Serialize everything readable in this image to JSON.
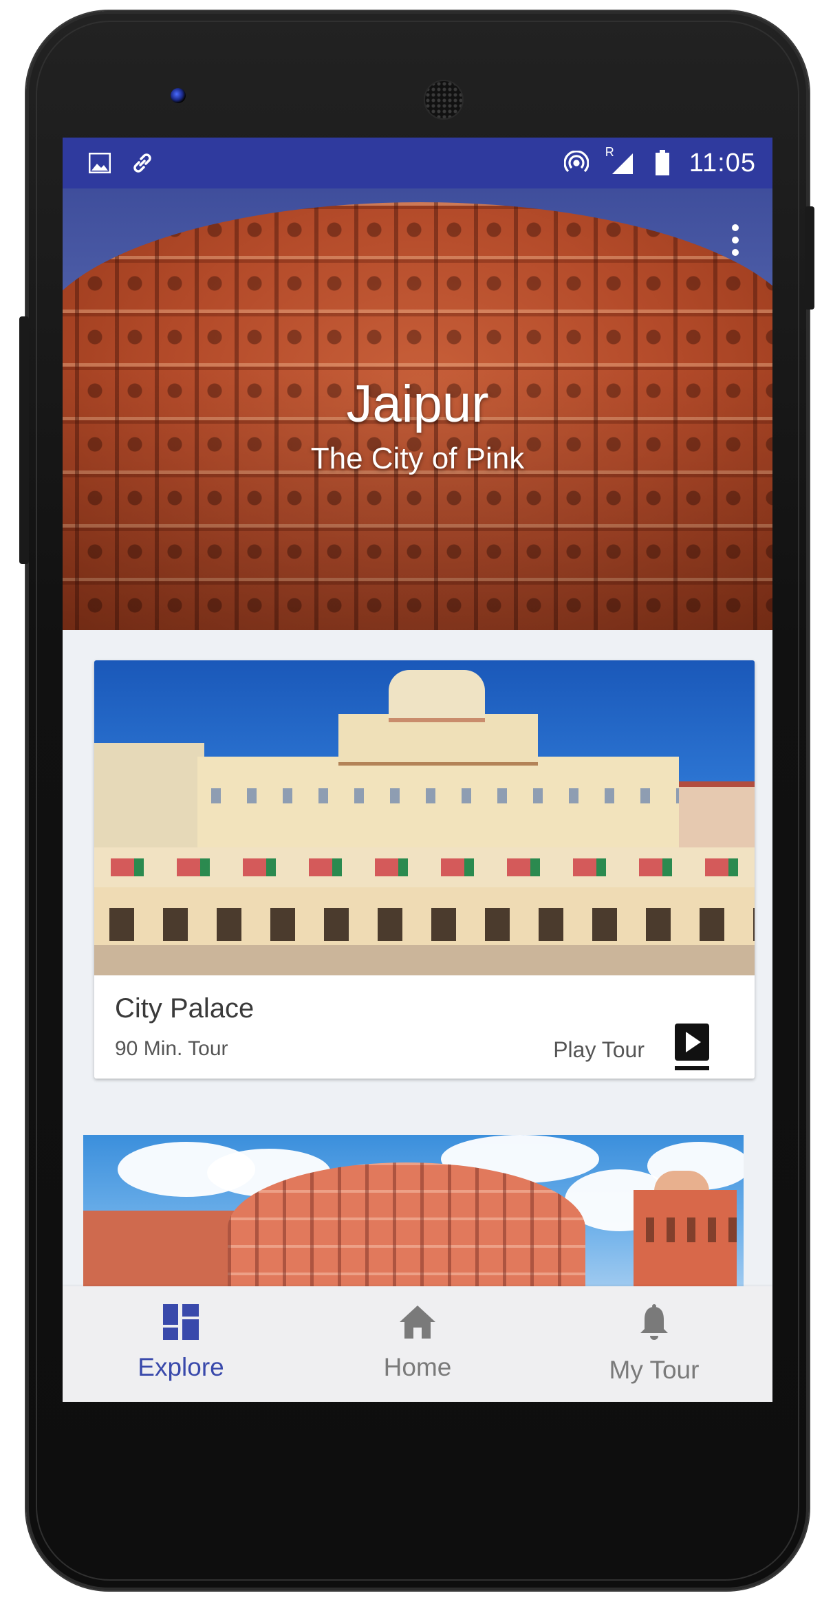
{
  "status_bar": {
    "time": "11:05",
    "roaming_label": "R",
    "icons": [
      "image-icon",
      "link-icon",
      "hotspot-icon",
      "signal-icon",
      "battery-icon"
    ]
  },
  "hero": {
    "title": "Jaipur",
    "subtitle": "The City of Pink",
    "menu_icon": "more-vert-icon"
  },
  "cards": [
    {
      "title": "City Palace",
      "subtitle": "90 Min. Tour",
      "action_label": "Play Tour",
      "action_icon": "play-icon"
    },
    {
      "title": "",
      "subtitle": ""
    }
  ],
  "bottom_nav": {
    "items": [
      {
        "label": "Explore",
        "icon": "dashboard-icon",
        "active": true
      },
      {
        "label": "Home",
        "icon": "home-icon",
        "active": false
      },
      {
        "label": "My Tour",
        "icon": "bell-icon",
        "active": false
      }
    ]
  },
  "colors": {
    "status_bar": "#2f3a9e",
    "accent": "#3949ab",
    "inactive": "#7a7a7a",
    "screen_bg": "#eef1f5"
  }
}
